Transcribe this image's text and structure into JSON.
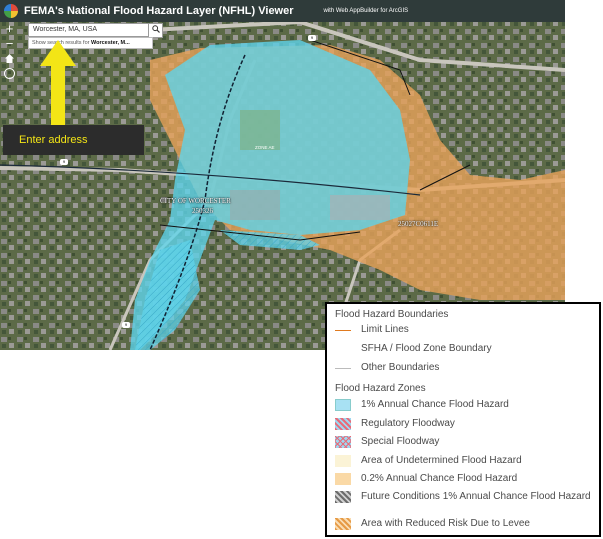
{
  "header": {
    "title": "FEMA's National Flood Hazard Layer (NFHL) Viewer",
    "subtitle": "with Web AppBuilder for ArcGIS"
  },
  "tools": {
    "zoom_in": "+",
    "zoom_out": "−",
    "home_icon": "home-icon",
    "locate_icon": "locate-icon"
  },
  "search": {
    "value": "Worcester, MA, USA",
    "suggestion_prefix": "Show search results for ",
    "suggestion_term": "Worcester, M..."
  },
  "annotation": {
    "label": "Enter address",
    "color": "#f3e516"
  },
  "map_labels": {
    "city": "CITY OF WORCESTER",
    "city_id": "250326",
    "date_tag": "25027C0611E",
    "zone_label": "ZONE AE"
  },
  "legend": {
    "boundaries_title": "Flood Hazard Boundaries",
    "boundaries": [
      {
        "symbol": "line-orange",
        "label": "Limit Lines"
      },
      {
        "symbol": "line-white",
        "label": "SFHA / Flood Zone Boundary"
      },
      {
        "symbol": "line-grey",
        "label": "Other Boundaries"
      }
    ],
    "zones_title": "Flood Hazard Zones",
    "zones": [
      {
        "symbol": "fill-blue",
        "label": "1% Annual Chance Flood Hazard"
      },
      {
        "symbol": "hatch-red",
        "label": "Regulatory Floodway"
      },
      {
        "symbol": "cross-red",
        "label": "Special Floodway"
      },
      {
        "symbol": "fill-cream",
        "label": "Area of Undetermined Flood Hazard"
      },
      {
        "symbol": "fill-peach",
        "label": "0.2% Annual Chance Flood Hazard"
      },
      {
        "symbol": "hatch-grey",
        "label": "Future Conditions 1% Annual Chance Flood Hazard"
      },
      {
        "symbol": "hatch-orange",
        "label": "Area with Reduced Risk Due to Levee"
      }
    ]
  },
  "colors": {
    "flood_blue": "#5fd3ea",
    "flood_orange": "#e8a35a",
    "header_bg": "#2f3b3a"
  }
}
